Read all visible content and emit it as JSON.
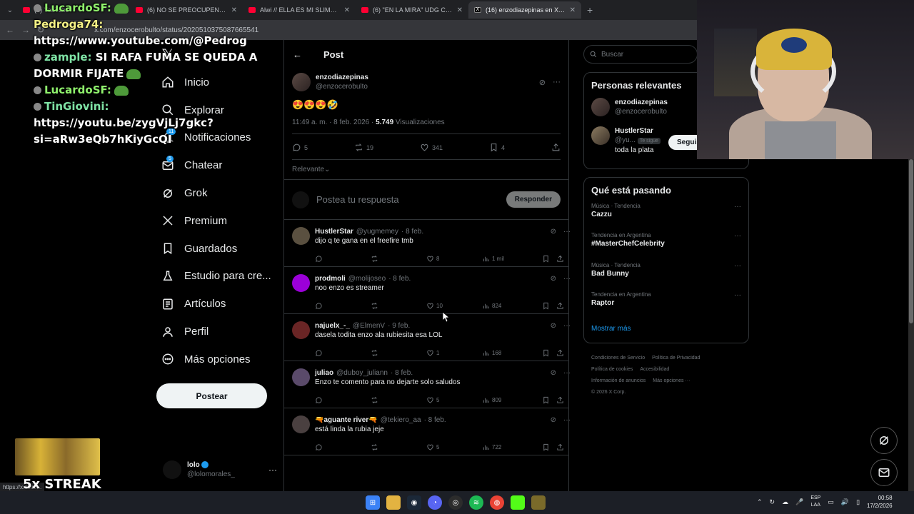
{
  "browser": {
    "tabs": [
      {
        "title": "(6) YouTube",
        "type": "yt"
      },
      {
        "title": "(6) NO SE PREOCUPEN - YouTu",
        "type": "yt"
      },
      {
        "title": "Alwi // ELLA ES MI SLIME (vide",
        "type": "yt"
      },
      {
        "title": "(6) \"EN LA MIRA\" UDG CYPHER",
        "type": "yt"
      },
      {
        "title": "(16) enzodiazepinas en X: \"@yu",
        "type": "x"
      }
    ],
    "new_tab": "+",
    "url": "x.com/enzocerobulto/status/2020510375087665541",
    "status_url": "https://x.com/..."
  },
  "chat": [
    {
      "user": "LucardoSF:",
      "text": "",
      "color": "green",
      "emote": true
    },
    {
      "user": "Pedroga74:",
      "text": " https://www.youtube.com/@Pedrog",
      "color": "yellow"
    },
    {
      "user": "zample:",
      "text": " SI RAFA FUMA SE QUEDA A DORMIR FIJATE",
      "color": "lime",
      "emote": true
    },
    {
      "user": "LucardoSF:",
      "text": "",
      "color": "green",
      "emote": true
    },
    {
      "user": "TinGiovini:",
      "text": " https://youtu.be/zygVjLj7gkc?si=aRw3eQb7hKiyGcQI",
      "color": "lime"
    }
  ],
  "nav": {
    "items": [
      {
        "label": "Inicio",
        "icon": "home-icon"
      },
      {
        "label": "Explorar",
        "icon": "search-icon"
      },
      {
        "label": "Notificaciones",
        "icon": "bell-icon",
        "badge": "11"
      },
      {
        "label": "Chatear",
        "icon": "mail-icon",
        "badge": "5"
      },
      {
        "label": "Grok",
        "icon": "grok-icon"
      },
      {
        "label": "Premium",
        "icon": "x-icon"
      },
      {
        "label": "Guardados",
        "icon": "bookmark-icon"
      },
      {
        "label": "Estudio para cre...",
        "icon": "flask-icon"
      },
      {
        "label": "Artículos",
        "icon": "article-icon"
      },
      {
        "label": "Perfil",
        "icon": "person-icon"
      },
      {
        "label": "Más opciones",
        "icon": "more-circle-icon"
      }
    ],
    "post_button": "Postear",
    "account": {
      "name": "lolo",
      "handle": "@lolomorales_"
    }
  },
  "main": {
    "header_title": "Post",
    "post": {
      "name": "enzodiazepinas",
      "handle": "@enzocerobulto",
      "text": "😍😍😍🤣",
      "time": "11:49 a. m. · 8 feb. 2026 · ",
      "views": "5.749",
      "views_label": " Visualizaciones",
      "replies": "5",
      "reposts": "19",
      "likes": "341",
      "bookmarks": "4"
    },
    "sort_label": "Relevante",
    "reply_placeholder": "Postea tu respuesta",
    "reply_button": "Responder",
    "replies": [
      {
        "name": "HustlerStar",
        "handle": "@yugmemey",
        "date": "· 8 feb.",
        "text": "dijo q te gana en el freefire tmb",
        "likes": "8",
        "views": "1 mil",
        "avatar": "#5a5040"
      },
      {
        "name": "prodmoli",
        "handle": "@molijoseo",
        "date": "· 8 feb.",
        "text": "noo enzo es streamer",
        "likes": "10",
        "views": "824",
        "avatar": "#9b00d8"
      },
      {
        "name": "najuelx_-_",
        "handle": "@ElmenV",
        "date": "· 9 feb.",
        "text": "dasela todita enzo ala rubiesita esa LOL",
        "likes": "1",
        "views": "168",
        "avatar": "#6a2525"
      },
      {
        "name": "juliao",
        "handle": "@duboy_juliann",
        "date": "· 8 feb.",
        "text": "Enzo te comento para no dejarte solo saludos",
        "likes": "5",
        "views": "809",
        "avatar": "#5a4a6a"
      },
      {
        "name": "🔫aguante river🔫",
        "handle": "@tekiero_aa",
        "date": "· 8 feb.",
        "text": "está linda la rubia jeje",
        "likes": "5",
        "views": "722",
        "avatar": "#4a4040"
      }
    ]
  },
  "sidebar": {
    "search_placeholder": "Buscar",
    "relevant_title": "Personas relevantes",
    "relevant_users": [
      {
        "name": "enzodiazepinas",
        "handle": "@enzocerobulto",
        "bio": ""
      },
      {
        "name": "HustlerStar",
        "handle": "@yu...",
        "follows_you": "Te sigue",
        "bio": "toda la plata"
      }
    ],
    "follow_button": "Seguir",
    "trends_title": "Qué está pasando",
    "trends": [
      {
        "category": "Música · Tendencia",
        "name": "Cazzu"
      },
      {
        "category": "Tendencia en Argentina",
        "name": "#MasterChefCelebrity"
      },
      {
        "category": "Música · Tendencia",
        "name": "Bad Bunny"
      },
      {
        "category": "Tendencia en Argentina",
        "name": "Raptor"
      }
    ],
    "show_more": "Mostrar más",
    "footer": [
      "Condiciones de Servicio",
      "Política de Privacidad",
      "Política de cookies",
      "Accesibilidad",
      "Información de anuncios",
      "Más opciones ···",
      "© 2026 X Corp."
    ]
  },
  "overlay": {
    "streak": "5x STREAK"
  },
  "taskbar": {
    "lang_top": "ESP",
    "lang_bottom": "LAA",
    "time": "00:58",
    "date": "17/2/2026"
  }
}
